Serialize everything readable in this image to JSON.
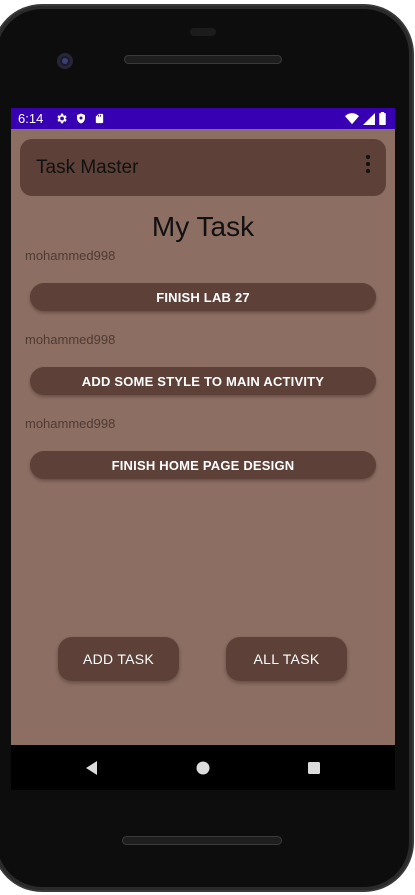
{
  "status_bar": {
    "time": "6:14",
    "left_icons": [
      "gear-icon",
      "shield-icon",
      "sd-card-icon"
    ],
    "right_icons": [
      "wifi-icon",
      "signal-icon",
      "battery-icon"
    ]
  },
  "app_bar": {
    "title": "Task Master",
    "menu_icon": "more-vert-icon"
  },
  "page": {
    "title": "My Task"
  },
  "tasks": [
    {
      "user": "mohammed998",
      "title": "FINISH LAB 27"
    },
    {
      "user": "mohammed998",
      "title": "ADD SOME STYLE TO MAIN ACTIVITY"
    },
    {
      "user": "mohammed998",
      "title": "FINISH HOME PAGE DESIGN"
    }
  ],
  "actions": {
    "add_label": "ADD TASK",
    "all_label": "ALL TASK"
  },
  "nav": {
    "icons": [
      "back-icon",
      "home-icon",
      "recents-icon"
    ]
  },
  "colors": {
    "status_bar": "#3700b3",
    "background": "#8d6e63",
    "primary": "#5d4037",
    "on_primary": "#ffffff"
  }
}
